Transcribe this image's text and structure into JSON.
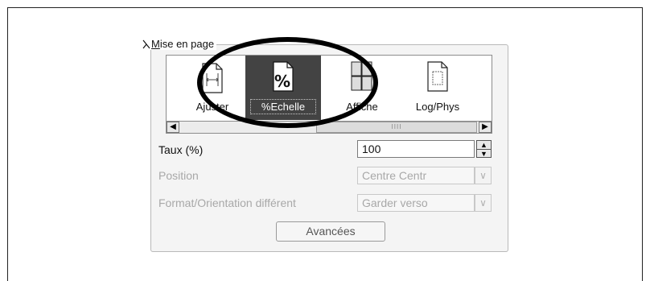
{
  "group": {
    "title_prefix": "M",
    "title_rest": "ise en page"
  },
  "layout_types": [
    {
      "label": "Ajuster",
      "icon": "fit-page-icon"
    },
    {
      "label": "%Echelle",
      "icon": "scale-percent-icon",
      "selected": true
    },
    {
      "label": "Affiche",
      "icon": "poster-icon"
    },
    {
      "label": "Log/Phys",
      "icon": "page-icon"
    }
  ],
  "fields": {
    "rate": {
      "label": "Taux (%)",
      "value": "100"
    },
    "position": {
      "label": "Position",
      "value": "Centre Centr"
    },
    "format": {
      "label": "Format/Orientation différent",
      "value": "Garder verso"
    }
  },
  "advanced_button": "Avancées",
  "scroll_grip": "IIII"
}
